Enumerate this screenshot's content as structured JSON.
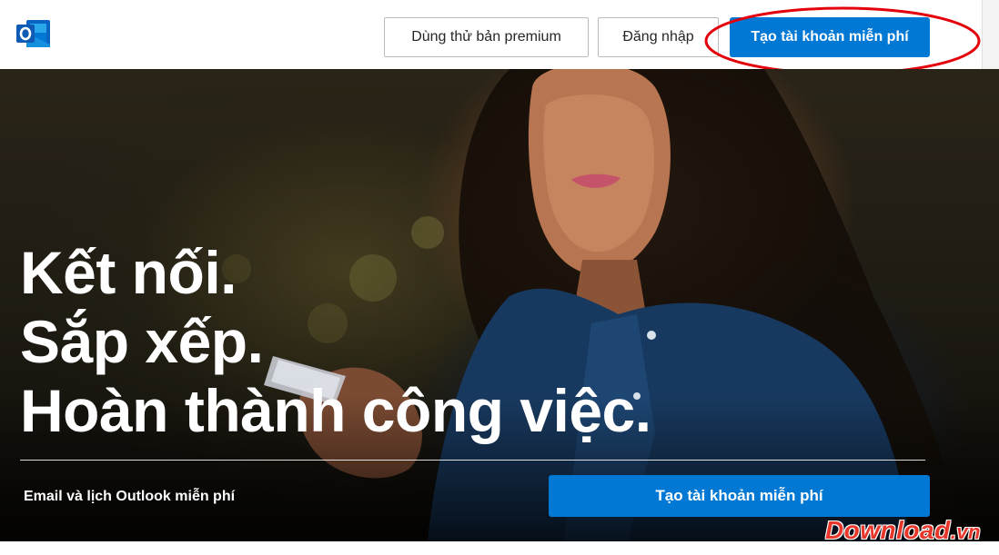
{
  "header": {
    "logo_icon": "outlook-logo-icon",
    "premium_label": "Dùng thử bản premium",
    "signin_label": "Đăng nhập",
    "create_account_label": "Tạo tài khoản miễn phí",
    "accent_color": "#0078d4",
    "highlight_color": "#e3000b"
  },
  "hero": {
    "headline": [
      "Kết nối.",
      "Sắp xếp.",
      "Hoàn thành công việc."
    ],
    "subline": "Email và lịch Outlook miễn phí",
    "cta_label": "Tạo tài khoản miễn phí"
  },
  "watermark": {
    "text": "Download",
    "tld": ".vn"
  }
}
